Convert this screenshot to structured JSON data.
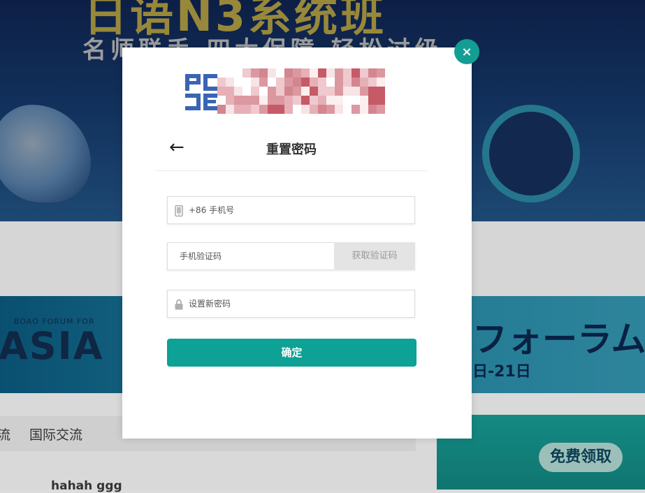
{
  "background": {
    "banner_title": "日语N3系统班",
    "banner_subtitle": "名师联手 四大保障 轻松过级",
    "asia_small": "BOAO FORUM FOR",
    "asia_big": "ASIA",
    "forum_text": "フォーラム",
    "forum_date": "日-21日",
    "nav_item_1": "流",
    "nav_item_2": "国际交流",
    "user_name": "hahah ggg",
    "side_pill": "免费领取"
  },
  "modal": {
    "close_icon": "×",
    "back_icon": "←",
    "title": "重置密码",
    "phone_placeholder": "+86 手机号",
    "code_placeholder": "手机验证码",
    "get_code_label": "获取验证码",
    "new_password_placeholder": "设置新密码",
    "submit_label": "确定",
    "accent_color": "#0ea195"
  }
}
